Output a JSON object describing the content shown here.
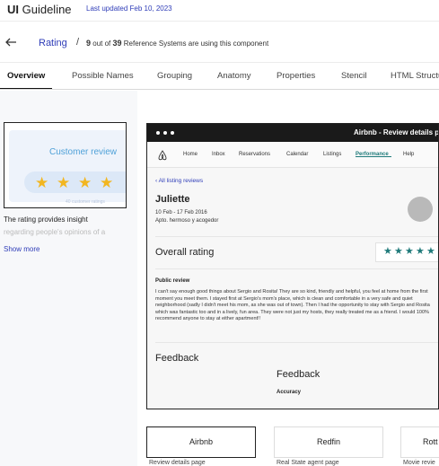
{
  "header": {
    "brand_bold": "UI",
    "brand_rest": " Guideline",
    "updated": "Last updated Feb 10, 2023"
  },
  "breadcrumb": {
    "back_icon": "arrow-left-icon",
    "title": "Rating",
    "separator": "/",
    "count": "9",
    "out_of": "out of",
    "total": "39",
    "suffix": "Reference Systems are using this component"
  },
  "tabs": [
    {
      "label": "Overview",
      "active": true
    },
    {
      "label": "Possible Names"
    },
    {
      "label": "Grouping"
    },
    {
      "label": "Anatomy"
    },
    {
      "label": "Properties"
    },
    {
      "label": "Stencil"
    },
    {
      "label": "HTML Structu"
    }
  ],
  "thumbnail": {
    "title": "Customer review",
    "footer": "40 customer ratings",
    "desc_line1": "The rating provides insight",
    "desc_line2": "regarding people's opinions of a",
    "show_more": "Show more"
  },
  "screenshot": {
    "window_title": "Airbnb - Review details p",
    "nav": [
      "Home",
      "Inbox",
      "Reservations",
      "Calendar",
      "Listings",
      "Performance",
      "Help"
    ],
    "nav_active": "Performance",
    "all_listing": "All listing reviews",
    "guest": "Juliette",
    "dates": "10 Feb - 17 Feb 2016",
    "apt": "Apto. hermoso y acogedor",
    "overall": "Overall rating",
    "stars": "★★★★★",
    "public_label": "Public review",
    "public_text": "I can't say enough good things about Sergio and Rosita! They are so kind, friendly and helpful, you feel at home from the first moment you meet them. I stayed first at Sergio's mom's place, which is clean and comfortable in a very safe and quiet neighborhood (sadly I didn't meet his mom, as she was out of town). Then I had the opportunity to stay with Sergio and Rosita which was fantastic too and in a lively, fun area. They were not just my hosts, they really treated me as a friend. I would 100% recommend anyone to stay at either apartment!!",
    "feedback1": "Feedback",
    "feedback2": "Feedback",
    "accuracy": "Accuracy"
  },
  "cards": [
    {
      "title": "Airbnb",
      "subtitle": "Review details page"
    },
    {
      "title": "Redfin",
      "subtitle": "Real State agent page"
    },
    {
      "title": "Rott",
      "subtitle": "Movie revie"
    }
  ],
  "colors": {
    "accent": "#2f3db8",
    "star_yellow": "#f2b620",
    "teal": "#1f7a7a"
  }
}
